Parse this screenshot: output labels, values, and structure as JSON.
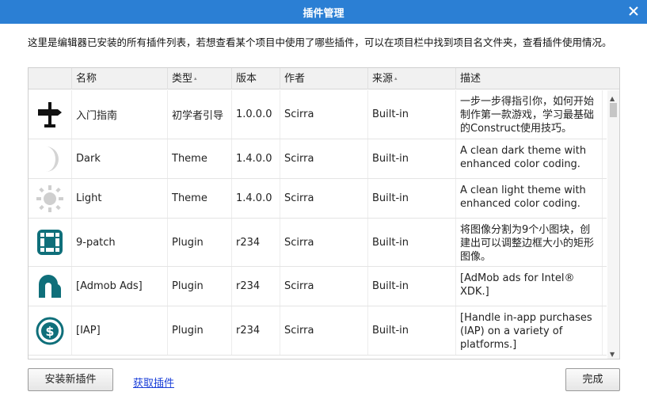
{
  "window": {
    "title": "插件管理"
  },
  "description": "这里是编辑器已安装的所有插件列表，若想查看某个项目中使用了哪些插件，可以在项目栏中找到项目名文件夹，查看插件使用情况。",
  "table": {
    "columns": [
      "名称",
      "类型",
      "版本",
      "作者",
      "来源",
      "描述"
    ],
    "rows": [
      {
        "icon": "signpost-icon",
        "name": "入门指南",
        "type": "初学者引导",
        "version": "1.0.0.0",
        "author": "Scirra",
        "source": "Built-in",
        "description": "一步一步得指引你，如何开始制作第一款游戏，学习最基础的Construct使用技巧。"
      },
      {
        "icon": "moon-icon",
        "name": "Dark",
        "type": "Theme",
        "version": "1.4.0.0",
        "author": "Scirra",
        "source": "Built-in",
        "description": "A clean dark theme with enhanced color coding."
      },
      {
        "icon": "sun-icon",
        "name": "Light",
        "type": "Theme",
        "version": "1.4.0.0",
        "author": "Scirra",
        "source": "Built-in",
        "description": "A clean light theme with enhanced color coding."
      },
      {
        "icon": "nine-patch-icon",
        "name": "9-patch",
        "type": "Plugin",
        "version": "r234",
        "author": "Scirra",
        "source": "Built-in",
        "description": "将图像分割为9个小图块，创建出可以调整边框大小的矩形图像。"
      },
      {
        "icon": "admob-icon",
        "name": "[Admob Ads]",
        "type": "Plugin",
        "version": "r234",
        "author": "Scirra",
        "source": "Built-in",
        "description": "[AdMob ads for Intel® XDK.]"
      },
      {
        "icon": "dollar-coin-icon",
        "name": "[IAP]",
        "type": "Plugin",
        "version": "r234",
        "author": "Scirra",
        "source": "Built-in",
        "description": "[Handle in-app purchases (IAP) on a variety of platforms.]"
      }
    ]
  },
  "buttons": {
    "install": "安装新插件",
    "get_plugins": "获取插件",
    "done": "完成"
  },
  "colors": {
    "titlebar": "#2b7fd4",
    "accent": "#0f6f7a"
  }
}
